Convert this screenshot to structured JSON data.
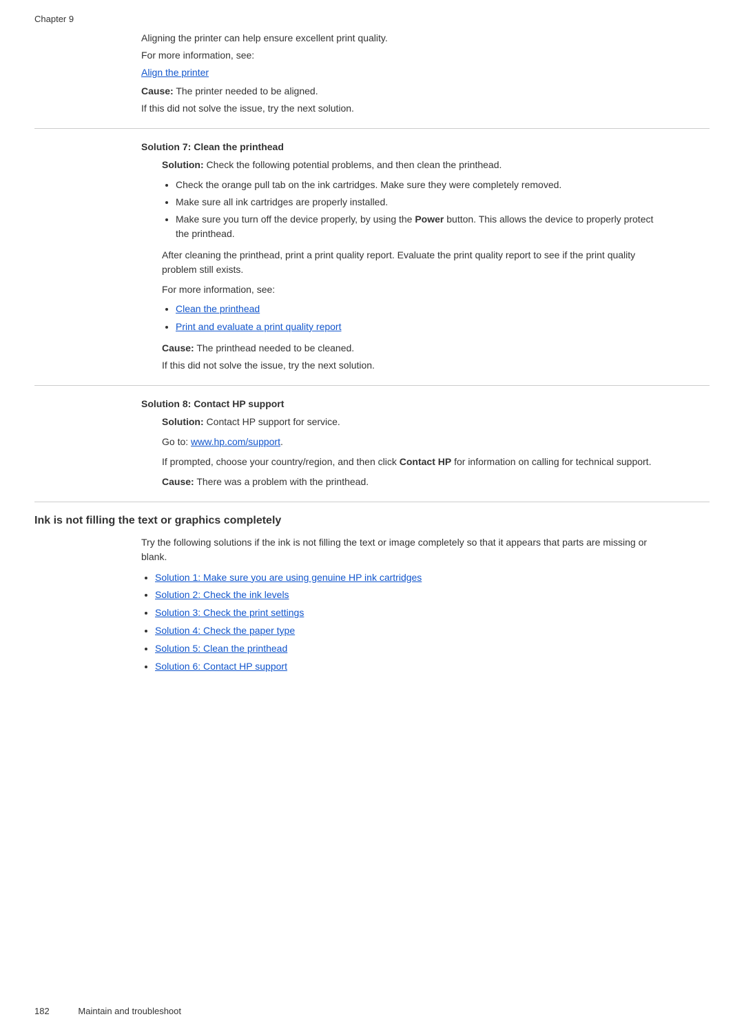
{
  "page": {
    "chapter": "Chapter 9",
    "footer_page": "182",
    "footer_text": "Maintain and troubleshoot"
  },
  "intro": {
    "line1": "Aligning the printer can help ensure excellent print quality.",
    "line2": "For more information, see:",
    "link": "Align the printer",
    "cause_label": "Cause:",
    "cause_text": "   The printer needed to be aligned.",
    "if_not_solve": "If this did not solve the issue, try the next solution."
  },
  "solution7": {
    "header": "Solution 7: Clean the printhead",
    "solution_label": "Solution:",
    "solution_text": "  Check the following potential problems, and then clean the printhead.",
    "bullets": [
      "Check the orange pull tab on the ink cartridges. Make sure they were completely removed.",
      "Make sure all ink cartridges are properly installed.",
      "Make sure you turn off the device properly, by using the Power button. This allows the device to properly protect the printhead."
    ],
    "after_text1": "After cleaning the printhead, print a print quality report. Evaluate the print quality report to see if the print quality problem still exists.",
    "for_more": "For more information, see:",
    "links": [
      "Clean the printhead",
      "Print and evaluate a print quality report"
    ],
    "cause_label": "Cause:",
    "cause_text": "   The printhead needed to be cleaned.",
    "if_not_solve": "If this did not solve the issue, try the next solution."
  },
  "solution8": {
    "header": "Solution 8: Contact HP support",
    "solution_label": "Solution:",
    "solution_text": "   Contact HP support for service.",
    "go_to_text": "Go to: ",
    "go_to_link": "www.hp.com/support",
    "go_to_end": ".",
    "if_prompted1": "If prompted, choose your country/region, and then click ",
    "contact_hp_bold": "Contact HP",
    "if_prompted2": " for information on calling for technical support.",
    "cause_label": "Cause:",
    "cause_text": "   There was a problem with the printhead."
  },
  "ink_section": {
    "title": "Ink is not filling the text or graphics completely",
    "intro": "Try the following solutions if the ink is not filling the text or image completely so that it appears that parts are missing or blank.",
    "links": [
      "Solution 1: Make sure you are using genuine HP ink cartridges",
      "Solution 2: Check the ink levels",
      "Solution 3: Check the print settings",
      "Solution 4: Check the paper type",
      "Solution 5: Clean the printhead",
      "Solution 6: Contact HP support"
    ]
  }
}
